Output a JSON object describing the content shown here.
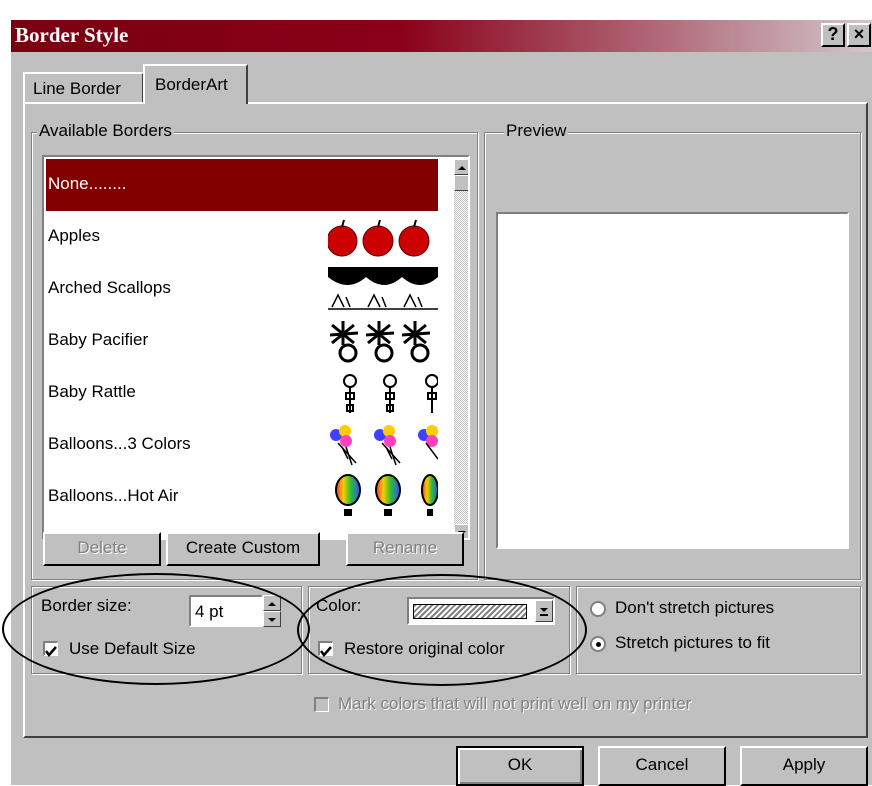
{
  "window": {
    "title": "Border Style",
    "help_button": "?",
    "close_button": "×"
  },
  "tabs": [
    {
      "label": "Line Border"
    },
    {
      "label": "BorderArt"
    }
  ],
  "available_borders": {
    "label": "Available Borders",
    "selected_index": 0,
    "items": [
      {
        "label": "None........",
        "art_icon": "none"
      },
      {
        "label": "Apples",
        "art_icon": "apple-icon"
      },
      {
        "label": "Arched Scallops",
        "art_icon": "arched-scallop-icon"
      },
      {
        "label": "Baby Pacifier",
        "art_icon": "baby-pacifier-icon"
      },
      {
        "label": "Baby Rattle",
        "art_icon": "baby-rattle-icon"
      },
      {
        "label": "Balloons...3 Colors",
        "art_icon": "balloons-icon"
      },
      {
        "label": "Balloons...Hot Air",
        "art_icon": "hot-air-balloon-icon"
      }
    ],
    "buttons": {
      "delete": "Delete",
      "create_custom": "Create Custom",
      "rename": "Rename"
    }
  },
  "preview": {
    "label": "Preview"
  },
  "border_size": {
    "label": "Border size:",
    "value": "4 pt",
    "use_default_label": "Use Default Size",
    "use_default_checked": true
  },
  "color": {
    "label": "Color:",
    "restore_label": "Restore original color",
    "restore_checked": true
  },
  "stretch": {
    "dont_stretch_label": "Don't stretch pictures",
    "stretch_fit_label": "Stretch pictures to fit",
    "selected": "Stretch pictures to fit"
  },
  "mark_colors": {
    "label": "Mark colors that will not print well on my printer",
    "checked": false,
    "enabled": false
  },
  "footer": {
    "ok": "OK",
    "cancel": "Cancel",
    "apply": "Apply"
  },
  "colors": {
    "title_bar": "#800000",
    "selection": "#800000",
    "dialog_face": "#c0c0c0"
  }
}
